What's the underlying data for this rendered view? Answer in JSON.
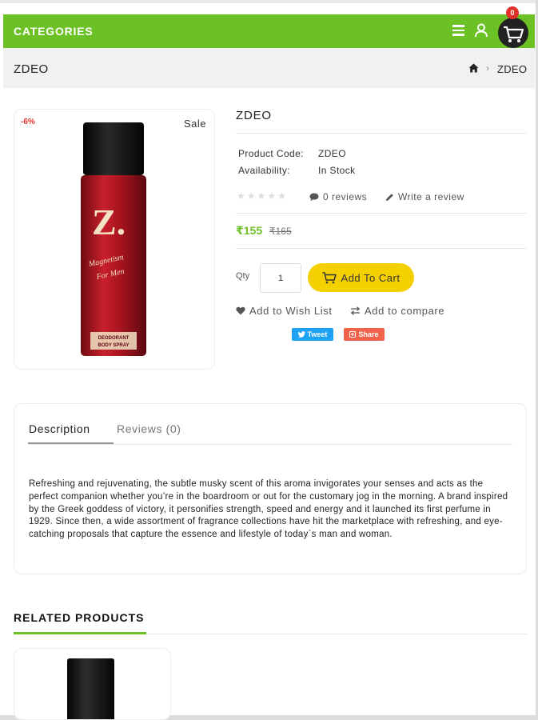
{
  "header": {
    "categories_label": "CATEGORIES",
    "cart_count": "0",
    "accent_color": "#6cc125"
  },
  "breadcrumb": {
    "page_title": "ZDEO",
    "current": "ZDEO"
  },
  "product": {
    "discount_badge": "-6%",
    "sale_badge": "Sale",
    "name": "ZDEO",
    "code_label": "Product Code:",
    "code_value": "ZDEO",
    "availability_label": "Availability:",
    "availability_value": "In Stock",
    "reviews_link": "0 reviews",
    "write_review": "Write a review",
    "price_new": "₹155",
    "price_old": "₹165",
    "qty_label": "Qty",
    "qty_value": "1",
    "add_to_cart": "Add To Cart",
    "wishlist": "Add to Wish List",
    "compare": "Add to compare",
    "tweet": "Tweet",
    "share": "Share",
    "rating": 0,
    "bottle_label_line1": "Magnetism",
    "bottle_label_line2": "For Men",
    "bottle_brand": "Z.",
    "bottle_type1": "DEODORANT",
    "bottle_type2": "BODY SPRAY"
  },
  "tabs": {
    "description": "Description",
    "reviews": "Reviews (0)"
  },
  "description_text": "Refreshing and rejuvenating, the subtle musky scent of this aroma invigorates your senses and acts as the perfect companion whether you’re in the boardroom or out for the customary jog in the morning. A brand inspired by the Greek goddess of victory, it personifies strength, speed and energy and it launched its first perfume in 1929. Since then, a wide assortment of fragrance collections have hit the marketplace with refreshing, and eye-catching proposals that capture the essence and lifestyle of today`s man and woman.",
  "related": {
    "title": "RELATED PRODUCTS"
  },
  "icons": [
    "menu-icon",
    "user-icon",
    "cart-icon",
    "home-icon",
    "comment-icon",
    "pencil-icon",
    "cart-button-icon",
    "heart-icon",
    "compare-icon",
    "twitter-icon",
    "share-icon"
  ]
}
